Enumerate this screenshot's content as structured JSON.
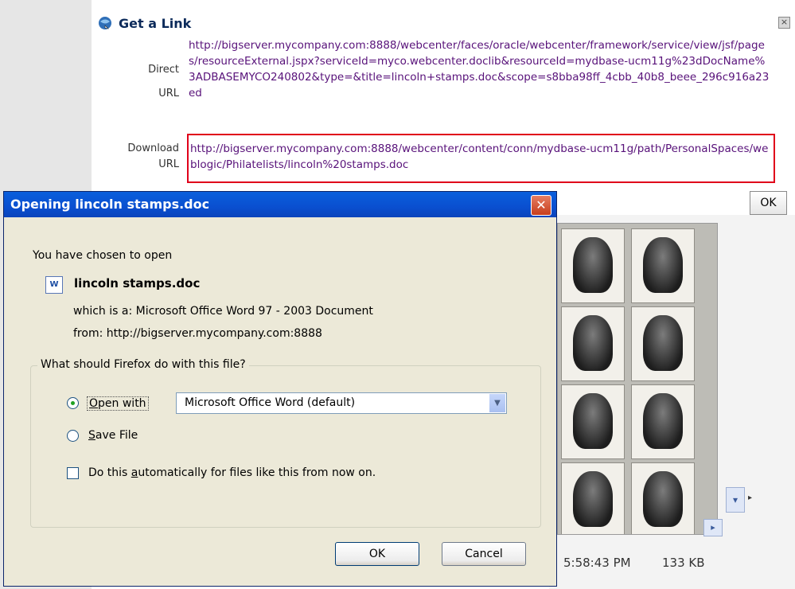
{
  "get_link": {
    "title": "Get a Link",
    "close_label": "×",
    "direct_label_line1": "Direct",
    "direct_label_line2": "URL",
    "direct_url": "http://bigserver.mycompany.com:8888/webcenter/faces/oracle/webcenter/framework/service/view/jsf/pages/resourceExternal.jspx?serviceId=myco.webcenter.doclib&resourceId=mydbase-ucm11g%23dDocName%3ADBASEMYCO240802&type=&title=lincoln+stamps.doc&scope=s8bba98ff_4cbb_40b8_beee_296c916a23ed",
    "download_label_line1": "Download",
    "download_label_line2": "URL",
    "download_url": "http://bigserver.mycompany.com:8888/webcenter/content/conn/mydbase-ucm11g/path/PersonalSpaces/weblogic/Philatelists/lincoln%20stamps.doc",
    "ok_label": "OK"
  },
  "background": {
    "time": "5:58:43 PM",
    "size": "133 KB"
  },
  "dialog": {
    "title": "Opening lincoln stamps.doc",
    "close_label": "✕",
    "intro": "You have chosen to open",
    "file_icon": "word-document-icon",
    "file_icon_text": "W",
    "file_name": "lincoln stamps.doc",
    "which_is": "which is a:  Microsoft Office Word 97 - 2003 Document",
    "from": "from:  http://bigserver.mycompany.com:8888",
    "question": "What should Firefox do with this file?",
    "open_with_first": "O",
    "open_with_rest": "pen with",
    "open_with_app": "Microsoft Office Word (default)",
    "save_first": "S",
    "save_rest": "ave File",
    "auto_before": "Do this ",
    "auto_accel": "a",
    "auto_after": "utomatically for files like this from now on.",
    "ok_label": "OK",
    "cancel_label": "Cancel",
    "selected_action": "open_with",
    "auto_checked": false
  }
}
